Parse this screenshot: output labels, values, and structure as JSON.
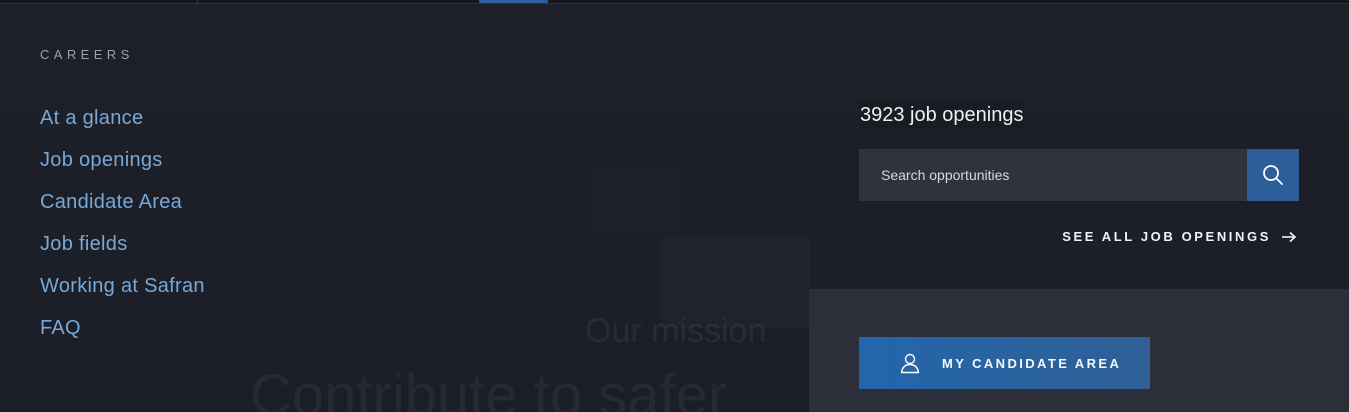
{
  "left_nav": {
    "section_label": "CAREERS",
    "items": [
      {
        "label": "At a glance"
      },
      {
        "label": "Job openings"
      },
      {
        "label": "Candidate Area"
      },
      {
        "label": "Job fields"
      },
      {
        "label": "Working at Safran"
      },
      {
        "label": "FAQ"
      }
    ]
  },
  "jobs": {
    "title": "3923 job openings",
    "search_placeholder": "Search opportunities",
    "see_all_label": "SEE ALL JOB OPENINGS",
    "candidate_button_label": "MY CANDIDATE AREA"
  },
  "background": {
    "mission_text": "Our mission",
    "contribute_text": "Contribute to safer"
  },
  "colors": {
    "accent_blue": "#2c5f99",
    "link_blue": "#78a8d6",
    "background": "#1d1f28",
    "panel": "#2c2e39"
  },
  "icons": {
    "search": "search-icon",
    "arrow": "arrow-right-icon",
    "user": "user-icon"
  }
}
